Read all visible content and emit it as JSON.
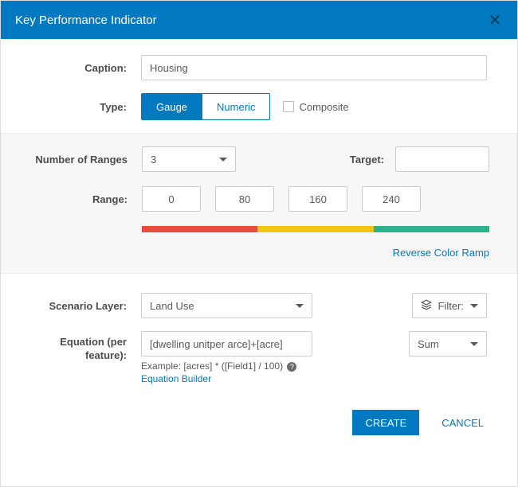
{
  "header": {
    "title": "Key Performance Indicator"
  },
  "caption": {
    "label": "Caption:",
    "value": "Housing"
  },
  "type": {
    "label": "Type:",
    "gauge": "Gauge",
    "numeric": "Numeric",
    "composite": "Composite"
  },
  "gauge": {
    "ranges_label": "Number of Ranges",
    "ranges_value": "3",
    "target_label": "Target:",
    "target_value": "",
    "range_label": "Range:",
    "range_values": [
      "0",
      "80",
      "160",
      "240"
    ],
    "reverse_label": "Reverse Color Ramp"
  },
  "scenario": {
    "label": "Scenario Layer:",
    "value": "Land Use",
    "filter_label": "Filter:"
  },
  "equation": {
    "label": "Equation (per feature):",
    "value": "[dwelling unitper arce]+[acre]",
    "aggregate": "Sum",
    "example": "Example: [acres] * ([Field1] / 100)",
    "builder": "Equation Builder"
  },
  "footer": {
    "create": "CREATE",
    "cancel": "CANCEL"
  }
}
